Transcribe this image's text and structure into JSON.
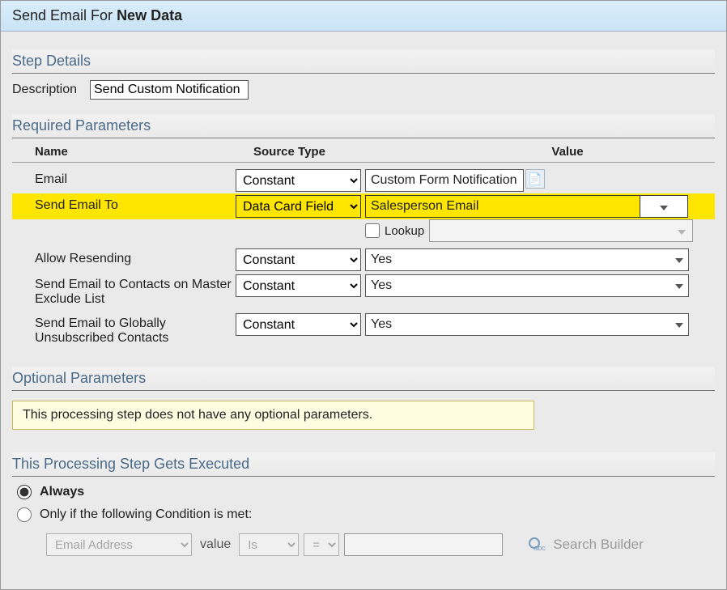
{
  "header": {
    "prefix": "Send Email For ",
    "bold": "New Data"
  },
  "sections": {
    "step_details": "Step Details",
    "required": "Required Parameters",
    "optional": "Optional Parameters",
    "exec": "This Processing Step Gets Executed"
  },
  "step": {
    "description_label": "Description",
    "description_value": "Send Custom Notification"
  },
  "columns": {
    "name": "Name",
    "source": "Source Type",
    "value": "Value"
  },
  "params": {
    "email": {
      "name": "Email",
      "source": "Constant",
      "value": "Custom Form Notification"
    },
    "sendto": {
      "name": "Send Email To",
      "source": "Data Card Field",
      "value": "Salesperson Email"
    },
    "lookup": {
      "label": "Lookup",
      "checked": false,
      "value": ""
    },
    "allow_resend": {
      "name": "Allow Resending",
      "source": "Constant",
      "value": "Yes"
    },
    "master_exclude": {
      "name": "Send Email to Contacts on Master Exclude List",
      "source": "Constant",
      "value": "Yes"
    },
    "global_unsub": {
      "name": "Send Email to Globally Unsubscribed Contacts",
      "source": "Constant",
      "value": "Yes"
    }
  },
  "optional_message": "This processing step does not have any optional parameters.",
  "exec": {
    "always": "Always",
    "only_if": "Only if the following Condition is met:",
    "cond_field": "Email Address",
    "cond_value_label": "value",
    "cond_op": "Is",
    "cond_eq": "=",
    "cond_blank": "",
    "search_builder": "Search Builder"
  }
}
